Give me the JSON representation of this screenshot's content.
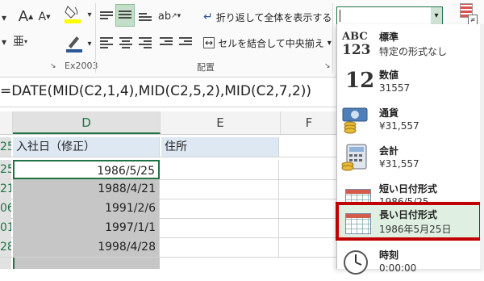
{
  "ribbon": {
    "font_grow": "A",
    "font_shrink": "A",
    "ex2003_label": "Ex2003",
    "wrap_text_label": "折り返して全体を表示する",
    "merge_center_label": "セルを結合して中央揃え",
    "alignment_group_label": "配置",
    "format_dropdown_value": ""
  },
  "formula_bar": {
    "formula": "=DATE(MID(C2,1,4),MID(C2,5,2),MID(C2,7,2))"
  },
  "sheet": {
    "columns": [
      "D",
      "E",
      "F"
    ],
    "rows": [
      {
        "rownum": "25",
        "d": "入社日（修正）",
        "e": "住所",
        "is_header": true
      },
      {
        "rownum": "25",
        "d": "1986/5/25",
        "e": ""
      },
      {
        "rownum": "21",
        "d": "1988/4/21",
        "e": ""
      },
      {
        "rownum": "06",
        "d": "1991/2/6",
        "e": ""
      },
      {
        "rownum": "01",
        "d": "1997/1/1",
        "e": ""
      },
      {
        "rownum": "28",
        "d": "1998/4/28",
        "e": ""
      }
    ]
  },
  "number_formats": [
    {
      "title": "標準",
      "sub": "特定の形式なし",
      "icon": "abc-123-icon"
    },
    {
      "title": "数値",
      "sub": "31557",
      "icon": "number-12-icon"
    },
    {
      "title": "通貨",
      "sub": "¥31,557",
      "icon": "currency-icon"
    },
    {
      "title": "会計",
      "sub": "¥31,557",
      "icon": "accounting-icon"
    },
    {
      "title": "短い日付形式",
      "sub": "1986/5/25",
      "icon": "calendar-icon"
    },
    {
      "title": "長い日付形式",
      "sub": "1986年5月25日",
      "icon": "calendar-icon",
      "highlighted": true
    },
    {
      "title": "時刻",
      "sub": "0:00:00",
      "icon": "clock-icon"
    }
  ],
  "colors": {
    "accent_green": "#217346",
    "highlight_fill": "#dff0e2",
    "highlight_border": "#c00000",
    "selected_cell_fill": "#c6c6c6"
  }
}
